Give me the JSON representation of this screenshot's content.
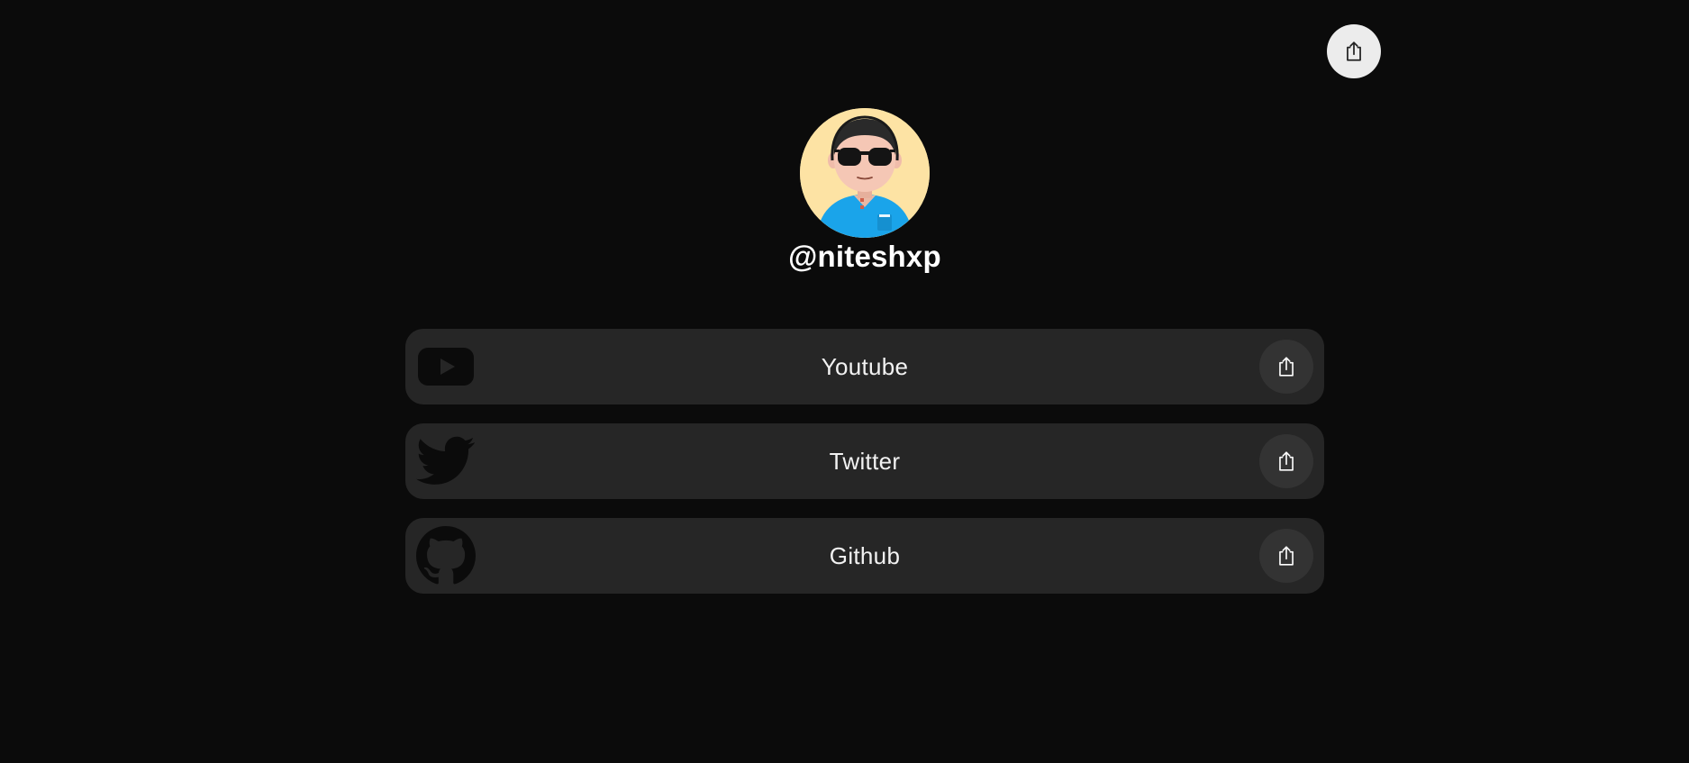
{
  "profile": {
    "handle": "@niteshxp",
    "avatar_icon": "avatar-3d-boy-sunglasses-icon"
  },
  "header": {
    "share_icon": "share-icon"
  },
  "links": [
    {
      "label": "Youtube",
      "icon": "youtube-icon",
      "share_icon": "share-icon"
    },
    {
      "label": "Twitter",
      "icon": "twitter-icon",
      "share_icon": "share-icon"
    },
    {
      "label": "Github",
      "icon": "github-icon",
      "share_icon": "share-icon"
    }
  ],
  "colors": {
    "background": "#0b0b0b",
    "card": "#262626",
    "card_share_button": "#333333",
    "top_share_button": "#ececec",
    "avatar_background": "#fde3a4",
    "shirt": "#1aa4ea",
    "text": "#ffffff"
  }
}
